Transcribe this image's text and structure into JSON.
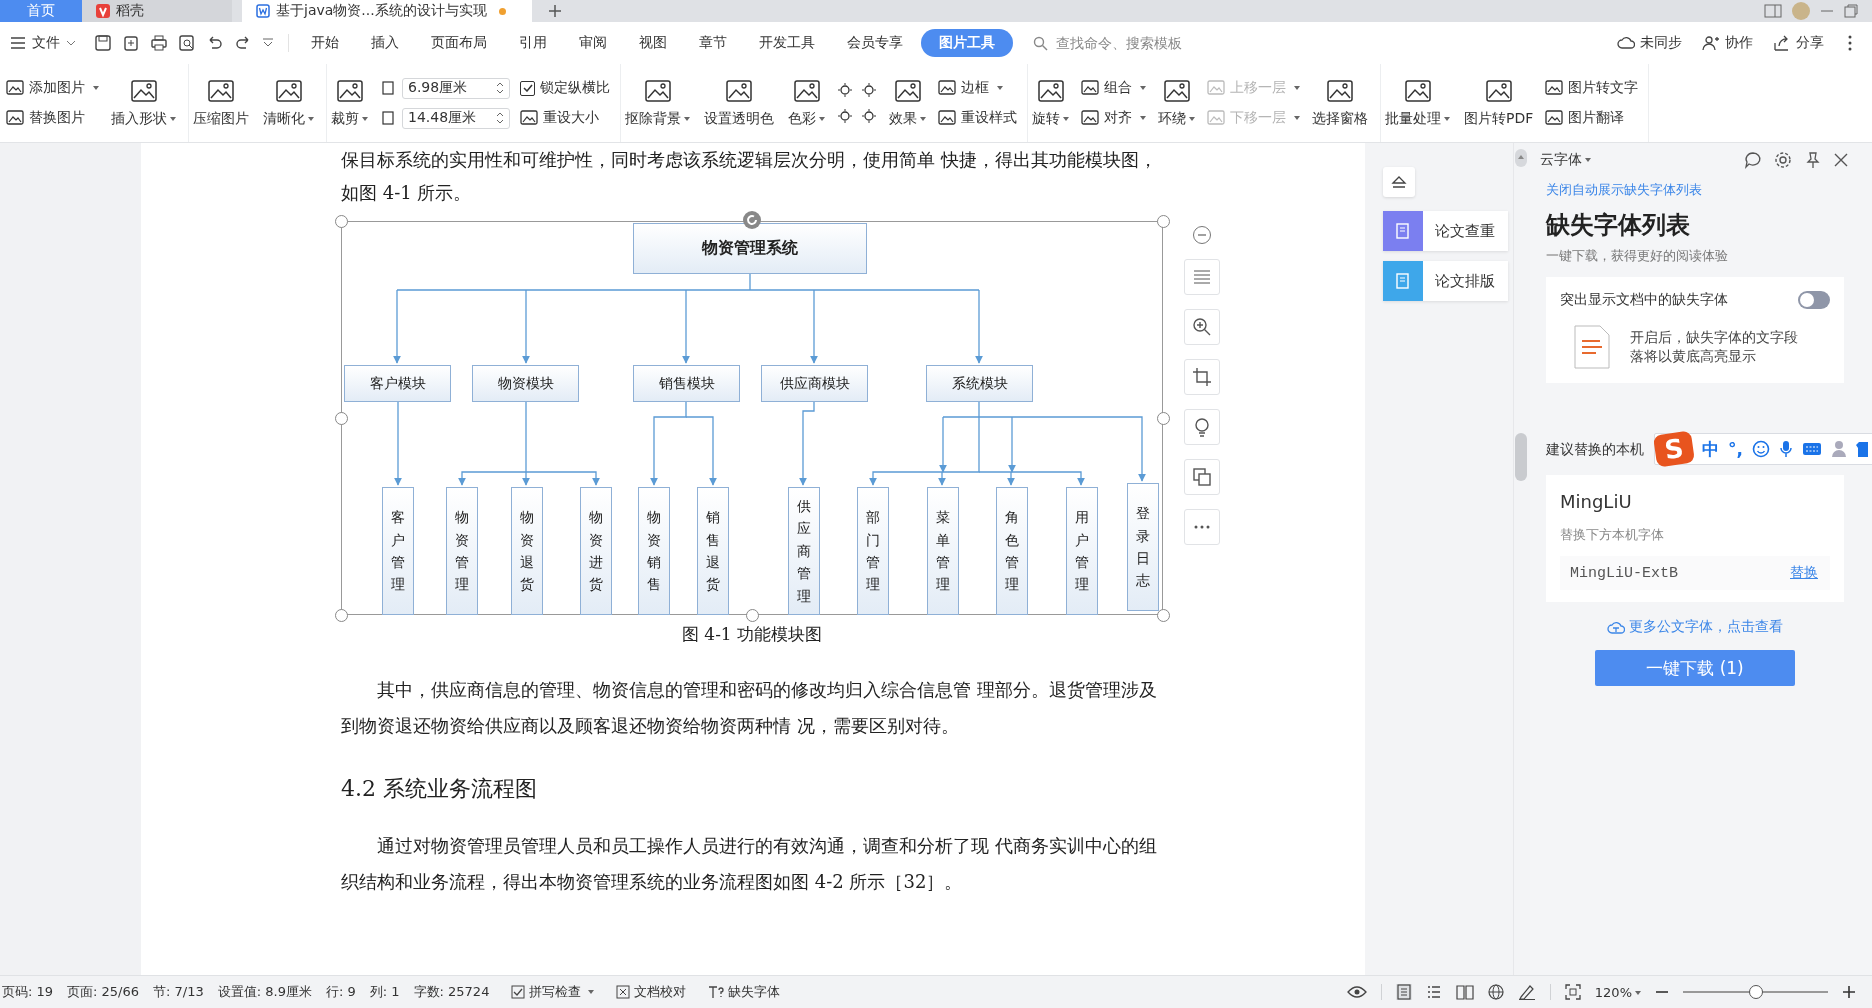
{
  "tabs": [
    {
      "label": "首页",
      "kind": "home",
      "selected": false
    },
    {
      "label": "稻壳",
      "kind": "app",
      "selected": false
    },
    {
      "label": "基于java物资...系统的设计与实现",
      "kind": "doc",
      "selected": true
    }
  ],
  "menu": {
    "file": "文件",
    "tabs": [
      {
        "label": "开始",
        "selected": false
      },
      {
        "label": "插入",
        "selected": false
      },
      {
        "label": "页面布局",
        "selected": false
      },
      {
        "label": "引用",
        "selected": false
      },
      {
        "label": "审阅",
        "selected": false
      },
      {
        "label": "视图",
        "selected": false
      },
      {
        "label": "章节",
        "selected": false
      },
      {
        "label": "开发工具",
        "selected": false
      },
      {
        "label": "会员专享",
        "selected": false
      },
      {
        "label": "图片工具",
        "selected": true
      }
    ],
    "search": {
      "placeholder": "查找命令、搜索模板"
    },
    "actions": [
      "未同步",
      "协作",
      "分享"
    ]
  },
  "ribbon": {
    "groups": [
      {
        "columns": [
          {
            "kind": "stack",
            "items": [
              {
                "kind": "button",
                "label": "添加图片",
                "dropdown": true,
                "disabled": false
              },
              {
                "kind": "button",
                "label": "替换图片",
                "dropdown": false,
                "disabled": false
              }
            ]
          },
          {
            "kind": "large",
            "label": "插入形状",
            "dropdown": true
          }
        ]
      },
      {
        "columns": [
          {
            "kind": "large",
            "label": "压缩图片",
            "dropdown": false
          },
          {
            "kind": "large",
            "label": "清晰化",
            "dropdown": true
          }
        ]
      },
      {
        "columns": [
          {
            "kind": "large",
            "label": "裁剪",
            "dropdown": true
          },
          {
            "kind": "sizes",
            "items": [
              {
                "value": "6.98厘米"
              },
              {
                "value": "14.48厘米"
              }
            ]
          },
          {
            "kind": "stack",
            "items": [
              {
                "kind": "check",
                "label": "锁定纵横比",
                "checked": true
              },
              {
                "kind": "button",
                "label": "重设大小",
                "dropdown": false,
                "disabled": false
              }
            ]
          }
        ]
      },
      {
        "columns": [
          {
            "kind": "large",
            "label": "抠除背景",
            "dropdown": true
          },
          {
            "kind": "large",
            "label": "设置透明色",
            "dropdown": false
          },
          {
            "kind": "large",
            "label": "色彩",
            "dropdown": true
          },
          {
            "kind": "icon_grid"
          },
          {
            "kind": "large",
            "label": "效果",
            "dropdown": true
          },
          {
            "kind": "stack",
            "items": [
              {
                "kind": "button",
                "label": "边框",
                "dropdown": true,
                "disabled": false
              },
              {
                "kind": "button",
                "label": "重设样式",
                "dropdown": false,
                "disabled": false
              }
            ]
          }
        ]
      },
      {
        "columns": [
          {
            "kind": "large",
            "label": "旋转",
            "dropdown": true
          },
          {
            "kind": "stack",
            "items": [
              {
                "kind": "button",
                "label": "组合",
                "dropdown": true,
                "disabled": false
              },
              {
                "kind": "button",
                "label": "对齐",
                "dropdown": true,
                "disabled": false
              }
            ]
          },
          {
            "kind": "large",
            "label": "环绕",
            "dropdown": true
          },
          {
            "kind": "stack",
            "items": [
              {
                "kind": "button",
                "label": "上移一层",
                "dropdown": true,
                "disabled": true
              },
              {
                "kind": "button",
                "label": "下移一层",
                "dropdown": true,
                "disabled": true
              }
            ]
          },
          {
            "kind": "large",
            "label": "选择窗格",
            "dropdown": false
          }
        ]
      },
      {
        "columns": [
          {
            "kind": "large",
            "label": "批量处理",
            "dropdown": true
          },
          {
            "kind": "large",
            "label": "图片转PDF",
            "dropdown": false
          },
          {
            "kind": "stack",
            "items": [
              {
                "kind": "button",
                "label": "图片转文字",
                "dropdown": false,
                "disabled": false
              },
              {
                "kind": "button",
                "label": "图片翻译",
                "dropdown": false,
                "disabled": false
              }
            ]
          }
        ]
      }
    ]
  },
  "document": {
    "intro": "保目标系统的实用性和可维护性，同时考虑该系统逻辑层次分明，使用简单 快捷，得出其功能模块图，如图 4-1 所示。",
    "figure": {
      "root": "物资管理系统",
      "modules": [
        {
          "label": "客户模块",
          "children": [
            {
              "label": "客户管理"
            }
          ]
        },
        {
          "label": "物资模块",
          "children": [
            {
              "label": "物资管理"
            },
            {
              "label": "物资退货"
            },
            {
              "label": "物资进货"
            }
          ]
        },
        {
          "label": "销售模块",
          "children": [
            {
              "label": "物资销售"
            },
            {
              "label": "销售退货"
            }
          ]
        },
        {
          "label": "供应商模块",
          "children": [
            {
              "label": "供应商管理"
            }
          ]
        },
        {
          "label": "系统模块",
          "children": [
            {
              "label": "部门管理"
            },
            {
              "label": "菜单管理"
            },
            {
              "label": "角色管理"
            },
            {
              "label": "用户管理"
            },
            {
              "label": "登录日志"
            }
          ]
        }
      ],
      "caption": "图 4-1 功能模块图"
    },
    "paragraph_1": "其中，供应商信息的管理、物资信息的管理和密码的修改均归入综合信息管 理部分。退货管理涉及到物资退还物资给供应商以及顾客退还物资给物资两种情 况，需要区别对待。",
    "heading": "4.2 系统业务流程图",
    "paragraph_2": "通过对物资管理员管理人员和员工操作人员进行的有效沟通，调查和分析了现 代商务实训中心的组织结构和业务流程，得出本物资管理系统的业务流程图如图 4-2 所示［32］。"
  },
  "side_tools": [
    {
      "label": "论文查重",
      "color": "#7b7ff0"
    },
    {
      "label": "论文排版",
      "color": "#3ea7ea"
    }
  ],
  "font_panel": {
    "title": "云字体",
    "close_auto_link": "关闭自动展示缺失字体列表",
    "heading": "缺失字体列表",
    "subtitle": "一键下载，获得更好的阅读体验",
    "highlight": {
      "label": "突出显示文档中的缺失字体",
      "on": false
    },
    "hint": "开启后，缺失字体的文字段落将以黄底高亮显示",
    "suggest_label": "建议替换的本机",
    "font": {
      "name": "MingLiU",
      "note": "替换下方本机字体",
      "replacement": "MingLiU-ExtB",
      "action": "替换"
    },
    "more_link": "更多公文字体，点击查看",
    "download_button": "一键下载 (1)"
  },
  "ime_toolbar": {
    "logo": "S",
    "mode": "中",
    "punct": "°,"
  },
  "status_bar": {
    "items": [
      "页码: 19",
      "页面: 25/66",
      "节: 7/13",
      "设置值: 8.9厘米",
      "行: 9",
      "列: 1",
      "字数: 25724"
    ],
    "tools": [
      "拼写检查",
      "文档校对",
      "缺失字体"
    ],
    "zoom": "120%",
    "zoom_slider": {
      "level": 0.5
    }
  }
}
